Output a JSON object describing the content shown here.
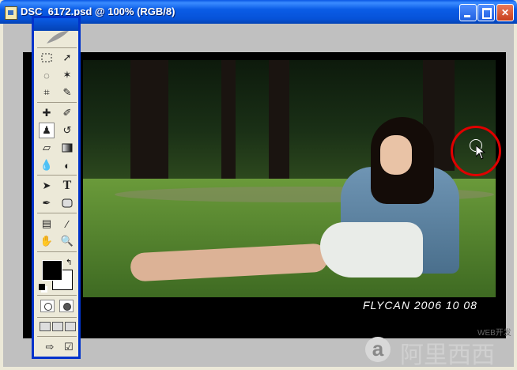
{
  "window": {
    "title": "DSC_6172.psd @ 100% (RGB/8)"
  },
  "photo": {
    "signature": "FLYCAN 2006 10 08"
  },
  "watermark": {
    "logo_letter": "a",
    "text": "阿里西西",
    "web_label": "WEB开发"
  },
  "colors": {
    "titlebar": "#0a5ce6",
    "toolbox_border": "#0033cc",
    "highlight_circle": "#e00000"
  },
  "toolbox": {
    "tools": [
      "marquee-icon",
      "move-icon",
      "lasso-icon",
      "magic-wand-icon",
      "crop-icon",
      "slice-icon",
      "healing-brush-icon",
      "brush-icon",
      "clone-stamp-icon",
      "history-brush-icon",
      "eraser-icon",
      "gradient-icon",
      "blur-icon",
      "dodge-icon",
      "path-select-icon",
      "type-icon",
      "pen-icon",
      "shape-icon",
      "notes-icon",
      "eyedropper-icon",
      "hand-icon",
      "zoom-icon"
    ],
    "type_glyph": "T"
  }
}
